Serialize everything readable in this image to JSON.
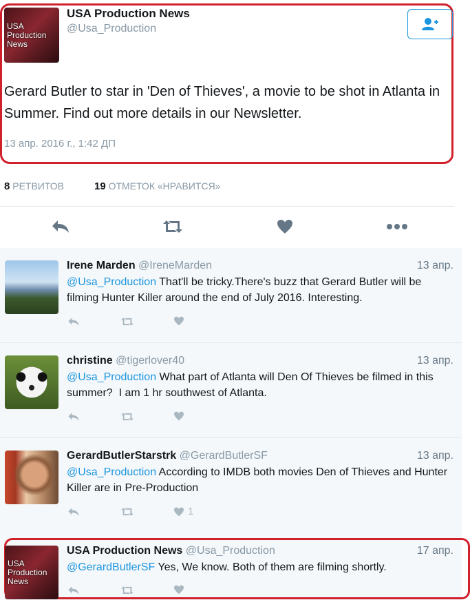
{
  "main_tweet": {
    "author_name": "USA Production News",
    "author_handle": "@Usa_Production",
    "avatar_text": [
      "USA",
      "Production",
      "News"
    ],
    "text": "Gerard Butler to star in 'Den of Thieves', a movie to be shot in Atlanta in Summer. Find out more details in our Newsletter.",
    "timestamp": "13 апр. 2016 г., 1:42 ДП"
  },
  "stats": {
    "retweets_count": "8",
    "retweets_label": "РЕТВИТОВ",
    "likes_count": "19",
    "likes_label": "ОТМЕТОК «НРАВИТСЯ»"
  },
  "actions": [
    "reply-icon",
    "retweet-icon",
    "heart-icon",
    "more-icon"
  ],
  "replies": [
    {
      "name": "Irene Marden",
      "handle": "@IreneMarden",
      "date": "13 апр.",
      "mention": "@Usa_Production",
      "text": " That'll be tricky.There's buzz that Gerard Butler will be filming Hunter Killer around the end of July 2016. Interesting.",
      "like_count": ""
    },
    {
      "name": "christine",
      "handle": "@tigerlover40",
      "date": "13 апр.",
      "mention": "@Usa_Production",
      "text": " What part of Atlanta will Den Of Thieves be filmed in this summer?  I am 1 hr southwest of Atlanta.",
      "like_count": ""
    },
    {
      "name": "GerardButlerStarstrk",
      "handle": "@GerardButlerSF",
      "date": "13 апр.",
      "mention": "@Usa_Production",
      "text": " According to IMDB both movies Den of Thieves and Hunter Killer are in Pre-Production",
      "like_count": "1"
    },
    {
      "name": "USA Production News",
      "handle": "@Usa_Production",
      "date": "17 апр.",
      "mention": "@GerardButlerSF",
      "text": " Yes, We know. Both of them are filming shortly.",
      "like_count": ""
    }
  ],
  "colors": {
    "accent": "#1b95e0",
    "highlight_border": "#d0212b",
    "muted": "#8899a6",
    "icon": "#aab8c2"
  }
}
